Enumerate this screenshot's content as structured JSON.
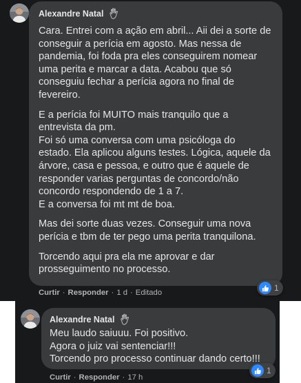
{
  "comments": [
    {
      "author": "Alexandre Natal",
      "paragraphs": [
        "Cara. Entrei com a ação em abril... Aii dei a sorte de\nconseguir a perícia em agosto. Mas nessa de\npandemia, foi foda pra eles conseguirem nomear\numa perita e marcar a data. Acabou que só\nconseguiu fechar a perícia agora no final de\nfevereiro.",
        "E a perícia foi MUITO mais tranquilo que a\nentrevista da pm.\nFoi só uma conversa com uma psicóloga do\nestado. Ela aplicou alguns testes. Lógica, aquele da\nárvore, casa e pessoa, e outro que é aquele de\nresponder varias perguntas de concordo/não\nconcordo respondendo de 1 a 7.\nE a conversa foi mt mt de boa.",
        "Mas dei sorte duas vezes. Conseguir uma nova\nperícia e tbm de ter pego uma perita tranquilona.",
        "Torcendo aqui pra ela me aprovar e dar\nprosseguimento no processo."
      ],
      "actions": {
        "like": "Curtir",
        "reply": "Responder",
        "time": "1 d",
        "edited": "Editado"
      },
      "reaction_count": "1"
    },
    {
      "author": "Alexandre Natal",
      "paragraphs": [
        "Meu laudo saiuuu. Foi positivo.\nAgora o juiz vai sentenciar!!!\nTorcendo pro processo continuar dando certo!!!"
      ],
      "actions": {
        "like": "Curtir",
        "reply": "Responder",
        "time": "17 h"
      },
      "reaction_count": "1"
    }
  ],
  "icons": {
    "badge": "waving-hand-icon",
    "reaction": "like-reaction-icon"
  },
  "colors": {
    "background": "#18191a",
    "bubble": "#3a3b3c",
    "text": "#e4e6eb",
    "secondary_text": "#b0b3b8",
    "like_blue": "#2e89ff"
  }
}
